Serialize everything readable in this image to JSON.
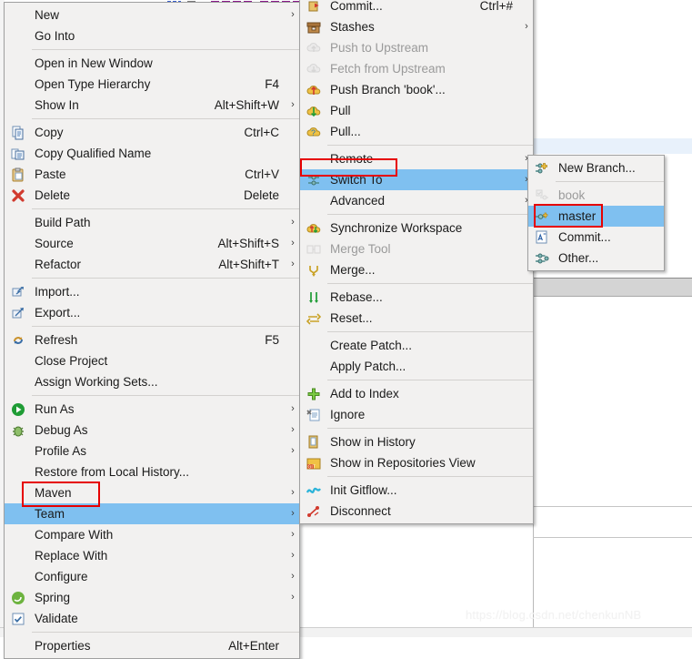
{
  "app": {
    "context": "Eclipse IDE project context menu with Team > Switch To submenu open",
    "watermark": "https://blog.csdn.net/chenkunNB"
  },
  "colors": {
    "menu_bg": "#f2f1f0",
    "menu_border": "#a0a0a0",
    "selection": "#7fc0f0",
    "annotation_red": "#e60000",
    "disabled_text": "#9a9a9a",
    "row_highlight": "#e8f1fb"
  },
  "main_menu": {
    "name": "project-context-menu",
    "items": [
      {
        "label": "New",
        "accel": "",
        "icon": "none",
        "arrow": true,
        "disabled": false,
        "selected": false
      },
      {
        "label": "Go Into",
        "accel": "",
        "icon": "none",
        "arrow": false,
        "disabled": false,
        "selected": false
      },
      {
        "separator": true
      },
      {
        "label": "Open in New Window",
        "accel": "",
        "icon": "none",
        "arrow": false,
        "disabled": false,
        "selected": false
      },
      {
        "label": "Open Type Hierarchy",
        "accel": "F4",
        "icon": "none",
        "arrow": false,
        "disabled": false,
        "selected": false
      },
      {
        "label": "Show In",
        "accel": "Alt+Shift+W",
        "icon": "none",
        "arrow": true,
        "disabled": false,
        "selected": false
      },
      {
        "separator": true
      },
      {
        "label": "Copy",
        "accel": "Ctrl+C",
        "icon": "copy-icon",
        "arrow": false,
        "disabled": false,
        "selected": false
      },
      {
        "label": "Copy Qualified Name",
        "accel": "",
        "icon": "copy-qualified-name-icon",
        "arrow": false,
        "disabled": false,
        "selected": false
      },
      {
        "label": "Paste",
        "accel": "Ctrl+V",
        "icon": "paste-icon",
        "arrow": false,
        "disabled": false,
        "selected": false
      },
      {
        "label": "Delete",
        "accel": "Delete",
        "icon": "delete-icon",
        "arrow": false,
        "disabled": false,
        "selected": false
      },
      {
        "separator": true
      },
      {
        "label": "Build Path",
        "accel": "",
        "icon": "none",
        "arrow": true,
        "disabled": false,
        "selected": false
      },
      {
        "label": "Source",
        "accel": "Alt+Shift+S",
        "icon": "none",
        "arrow": true,
        "disabled": false,
        "selected": false
      },
      {
        "label": "Refactor",
        "accel": "Alt+Shift+T",
        "icon": "none",
        "arrow": true,
        "disabled": false,
        "selected": false
      },
      {
        "separator": true
      },
      {
        "label": "Import...",
        "accel": "",
        "icon": "import-icon",
        "arrow": false,
        "disabled": false,
        "selected": false
      },
      {
        "label": "Export...",
        "accel": "",
        "icon": "export-icon",
        "arrow": false,
        "disabled": false,
        "selected": false
      },
      {
        "separator": true
      },
      {
        "label": "Refresh",
        "accel": "F5",
        "icon": "refresh-icon",
        "arrow": false,
        "disabled": false,
        "selected": false
      },
      {
        "label": "Close Project",
        "accel": "",
        "icon": "none",
        "arrow": false,
        "disabled": false,
        "selected": false
      },
      {
        "label": "Assign Working Sets...",
        "accel": "",
        "icon": "none",
        "arrow": false,
        "disabled": false,
        "selected": false
      },
      {
        "separator": true
      },
      {
        "label": "Run As",
        "accel": "",
        "icon": "run-icon",
        "arrow": true,
        "disabled": false,
        "selected": false
      },
      {
        "label": "Debug As",
        "accel": "",
        "icon": "debug-icon",
        "arrow": true,
        "disabled": false,
        "selected": false
      },
      {
        "label": "Profile As",
        "accel": "",
        "icon": "none",
        "arrow": true,
        "disabled": false,
        "selected": false
      },
      {
        "label": "Restore from Local History...",
        "accel": "",
        "icon": "none",
        "arrow": false,
        "disabled": false,
        "selected": false
      },
      {
        "label": "Maven",
        "accel": "",
        "icon": "none",
        "arrow": true,
        "disabled": false,
        "selected": false
      },
      {
        "label": "Team",
        "accel": "",
        "icon": "none",
        "arrow": true,
        "disabled": false,
        "selected": true,
        "annotated": true
      },
      {
        "label": "Compare With",
        "accel": "",
        "icon": "none",
        "arrow": true,
        "disabled": false,
        "selected": false
      },
      {
        "label": "Replace With",
        "accel": "",
        "icon": "none",
        "arrow": true,
        "disabled": false,
        "selected": false
      },
      {
        "label": "Configure",
        "accel": "",
        "icon": "none",
        "arrow": true,
        "disabled": false,
        "selected": false
      },
      {
        "label": "Spring",
        "accel": "",
        "icon": "spring-icon",
        "arrow": true,
        "disabled": false,
        "selected": false
      },
      {
        "label": "Validate",
        "accel": "",
        "icon": "validate-icon",
        "arrow": false,
        "disabled": false,
        "selected": false
      },
      {
        "separator": true
      },
      {
        "label": "Properties",
        "accel": "Alt+Enter",
        "icon": "none",
        "arrow": false,
        "disabled": false,
        "selected": false
      }
    ]
  },
  "team_menu": {
    "name": "team-submenu",
    "items": [
      {
        "label": "Commit...",
        "accel": "Ctrl+#",
        "icon": "commit-icon",
        "arrow": false,
        "disabled": false,
        "selected": false
      },
      {
        "label": "Stashes",
        "accel": "",
        "icon": "stashes-icon",
        "arrow": true,
        "disabled": false,
        "selected": false
      },
      {
        "label": "Push to Upstream",
        "accel": "",
        "icon": "push-upstream-icon",
        "arrow": false,
        "disabled": true,
        "selected": false
      },
      {
        "label": "Fetch from Upstream",
        "accel": "",
        "icon": "fetch-upstream-icon",
        "arrow": false,
        "disabled": true,
        "selected": false
      },
      {
        "label": "Push Branch 'book'...",
        "accel": "",
        "icon": "push-branch-icon",
        "arrow": false,
        "disabled": false,
        "selected": false
      },
      {
        "label": "Pull",
        "accel": "",
        "icon": "pull-icon",
        "arrow": false,
        "disabled": false,
        "selected": false
      },
      {
        "label": "Pull...",
        "accel": "",
        "icon": "pull-dialog-icon",
        "arrow": false,
        "disabled": false,
        "selected": false
      },
      {
        "separator": true
      },
      {
        "label": "Remote",
        "accel": "",
        "icon": "none",
        "arrow": true,
        "disabled": false,
        "selected": false
      },
      {
        "label": "Switch To",
        "accel": "",
        "icon": "switch-to-icon",
        "arrow": true,
        "disabled": false,
        "selected": true,
        "annotated": true
      },
      {
        "label": "Advanced",
        "accel": "",
        "icon": "none",
        "arrow": true,
        "disabled": false,
        "selected": false
      },
      {
        "separator": true
      },
      {
        "label": "Synchronize Workspace",
        "accel": "",
        "icon": "synchronize-icon",
        "arrow": false,
        "disabled": false,
        "selected": false
      },
      {
        "label": "Merge Tool",
        "accel": "",
        "icon": "merge-tool-icon",
        "arrow": false,
        "disabled": true,
        "selected": false
      },
      {
        "label": "Merge...",
        "accel": "",
        "icon": "merge-icon",
        "arrow": false,
        "disabled": false,
        "selected": false
      },
      {
        "separator": true
      },
      {
        "label": "Rebase...",
        "accel": "",
        "icon": "rebase-icon",
        "arrow": false,
        "disabled": false,
        "selected": false
      },
      {
        "label": "Reset...",
        "accel": "",
        "icon": "reset-icon",
        "arrow": false,
        "disabled": false,
        "selected": false
      },
      {
        "separator": true
      },
      {
        "label": "Create Patch...",
        "accel": "",
        "icon": "none",
        "arrow": false,
        "disabled": false,
        "selected": false
      },
      {
        "label": "Apply Patch...",
        "accel": "",
        "icon": "none",
        "arrow": false,
        "disabled": false,
        "selected": false
      },
      {
        "separator": true
      },
      {
        "label": "Add to Index",
        "accel": "",
        "icon": "add-to-index-icon",
        "arrow": false,
        "disabled": false,
        "selected": false
      },
      {
        "label": "Ignore",
        "accel": "",
        "icon": "ignore-icon",
        "arrow": false,
        "disabled": false,
        "selected": false
      },
      {
        "separator": true
      },
      {
        "label": "Show in History",
        "accel": "",
        "icon": "history-icon",
        "arrow": false,
        "disabled": false,
        "selected": false
      },
      {
        "label": "Show in Repositories View",
        "accel": "",
        "icon": "repositories-view-icon",
        "arrow": false,
        "disabled": false,
        "selected": false
      },
      {
        "separator": true
      },
      {
        "label": "Init Gitflow...",
        "accel": "",
        "icon": "gitflow-icon",
        "arrow": false,
        "disabled": false,
        "selected": false
      },
      {
        "label": "Disconnect",
        "accel": "",
        "icon": "disconnect-icon",
        "arrow": false,
        "disabled": false,
        "selected": false
      }
    ]
  },
  "switch_menu": {
    "name": "switch-to-submenu",
    "items": [
      {
        "label": "New Branch...",
        "accel": "",
        "icon": "new-branch-icon",
        "arrow": false,
        "disabled": false,
        "selected": false
      },
      {
        "separator": true
      },
      {
        "label": "book",
        "accel": "",
        "icon": "branch-current-icon",
        "arrow": false,
        "disabled": true,
        "selected": false
      },
      {
        "label": "master",
        "accel": "",
        "icon": "branch-icon",
        "arrow": false,
        "disabled": false,
        "selected": true,
        "annotated": true
      },
      {
        "label": "Commit...",
        "accel": "",
        "icon": "commit-ref-icon",
        "arrow": false,
        "disabled": false,
        "selected": false
      },
      {
        "label": "Other...",
        "accel": "",
        "icon": "other-branch-icon",
        "arrow": false,
        "disabled": false,
        "selected": false
      }
    ]
  },
  "annotations": [
    {
      "name": "team-highlight-box",
      "target": "Team"
    },
    {
      "name": "switch-to-highlight-box",
      "target": "Switch To"
    },
    {
      "name": "master-highlight-box",
      "target": "master"
    }
  ]
}
